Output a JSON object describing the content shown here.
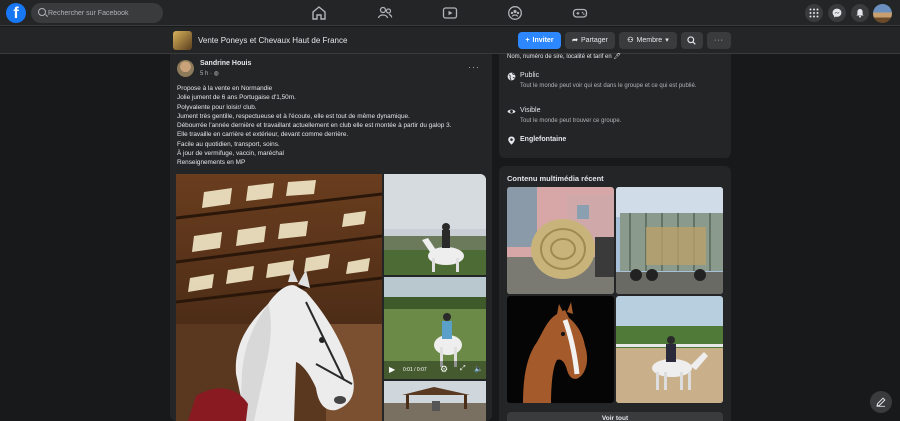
{
  "topbar": {
    "logo": "f",
    "search_placeholder": "Rechercher sur Facebook"
  },
  "group": {
    "name": "Vente Poneys et Chevaux Haut de France",
    "invite_label": "Inviter",
    "share_label": "Partager",
    "member_label": "Membre"
  },
  "post": {
    "author": "Sandrine Houis",
    "time": "5 h · ",
    "lines": [
      "Propose à la vente en Normandie",
      "Jolie jument de 6 ans Portugaise d'1,50m.",
      "Polyvalente pour loisir/ club.",
      "Jument très gentille, respectueuse et à l'écoute, elle est tout de même dynamique.",
      "Débourrée l'année dernière et travaillant actuellement en club elle est montée à partir du galop 3.",
      "Elle travaille en carrière et extérieur, devant comme derrière.",
      "Facile au quotidien, transport, soins.",
      "À jour de vermifuge, vaccin, maréchal",
      "Renseignements en MP"
    ],
    "video_time": "0:01 / 0:07"
  },
  "about": {
    "top_line": "Nom, numéro de sire, localité et tarif en 🖊",
    "public_title": "Public",
    "public_desc": "Tout le monde peut voir qui est dans le groupe et ce qui est publié.",
    "visible_title": "Visible",
    "visible_desc": "Tout le monde peut trouver ce groupe.",
    "location": "Englefontaine"
  },
  "media": {
    "title": "Contenu multimédia récent",
    "see_all": "Voir tout"
  }
}
